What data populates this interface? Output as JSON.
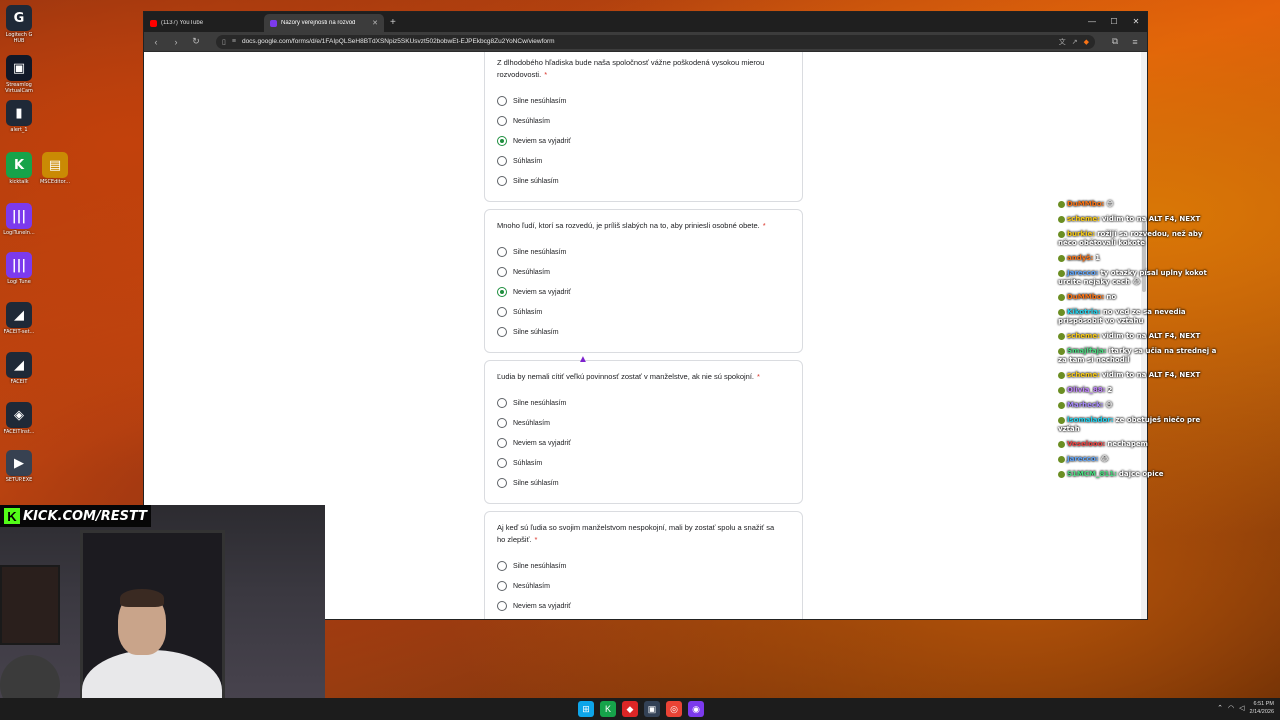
{
  "desktop": {
    "icons": [
      {
        "name": "logitech-ghub-icon",
        "label": "Logitech G HUB",
        "glyph": "G",
        "color": "#1f2937"
      },
      {
        "name": "streamlabs-icon",
        "label": "Streamlog VirtualCam",
        "glyph": "▣",
        "color": "#111827"
      },
      {
        "name": "alert-icon",
        "label": "alert_1",
        "glyph": "▮",
        "color": "#1f2937"
      },
      {
        "name": "kicktalk-icon",
        "label": "kicktalk",
        "glyph": "K",
        "color": "#16a34a"
      },
      {
        "name": "msceditor-icon",
        "label": "MSCEditor...",
        "glyph": "▤",
        "color": "#ca8a04"
      },
      {
        "name": "logi-tune-icon-1",
        "label": "LogiTuneIn...",
        "glyph": "|||",
        "color": "#7c3aed"
      },
      {
        "name": "logi-tune-icon-2",
        "label": "Logi Tune",
        "glyph": "|||",
        "color": "#7c3aed"
      },
      {
        "name": "faceit-setup-icon",
        "label": "FACEIT-set...",
        "glyph": "◢",
        "color": "#1f2937"
      },
      {
        "name": "faceit-icon",
        "label": "FACEIT",
        "glyph": "◢",
        "color": "#1f2937"
      },
      {
        "name": "faceit-inst-icon",
        "label": "FACEITInst...",
        "glyph": "◈",
        "color": "#1f2937"
      },
      {
        "name": "setup-icon",
        "label": "SETUP.EXE",
        "glyph": "▶",
        "color": "#374151"
      }
    ]
  },
  "browser": {
    "tabs": [
      {
        "title": "(1137) YouTube",
        "fav": "#ff0000"
      },
      {
        "title": "Názory verejnosti na rozvod",
        "fav": "#7c3aed"
      }
    ],
    "new_tab": "+",
    "url": "docs.google.com/forms/d/e/1FAIpQLSeH8BTdXSNpiz5SKUsvzt502bobwEt-EJPEkbcg8Zu2YoNCw/viewform"
  },
  "form": {
    "cards": [
      {
        "question": "Z dlhodobého hľadiska bude naša spoločnosť vážne poškodená vysokou mierou rozvodovosti.",
        "required": "*",
        "selected": 2,
        "options": [
          "Silne nesúhlasím",
          "Nesúhlasím",
          "Neviem sa vyjadriť",
          "Súhlasím",
          "Silne súhlasím"
        ]
      },
      {
        "question": "Mnoho ľudí, ktorí sa rozvedú, je príliš slabých na to, aby priniesli osobné obete.",
        "required": "*",
        "selected": 2,
        "options": [
          "Silne nesúhlasím",
          "Nesúhlasím",
          "Neviem sa vyjadriť",
          "Súhlasím",
          "Silne súhlasím"
        ]
      },
      {
        "question": "Ľudia by nemali cítiť veľkú povinnosť zostať v manželstve, ak nie sú spokojní.",
        "required": "*",
        "selected": -1,
        "options": [
          "Silne nesúhlasím",
          "Nesúhlasím",
          "Neviem sa vyjadriť",
          "Súhlasím",
          "Silne súhlasím"
        ]
      },
      {
        "question": "Aj keď sú ľudia so svojim manželstvom nespokojní, mali by zostať spolu a snažiť sa ho zlepšiť.",
        "required": "*",
        "selected": -1,
        "options": [
          "Silne nesúhlasím",
          "Nesúhlasím",
          "Neviem sa vyjadriť"
        ]
      }
    ]
  },
  "chat": [
    {
      "user": "DuMMbo:",
      "msg": "😊",
      "color": "#f97316"
    },
    {
      "user": "scheme:",
      "msg": "vidim to na ALT F4, NEXT",
      "color": "#facc15"
    },
    {
      "user": "burkie:",
      "msg": "rožijí sa rozvedou, než aby něco obětovali kokote",
      "color": "#facc15"
    },
    {
      "user": "andyš:",
      "msg": "1",
      "color": "#f97316"
    },
    {
      "user": "Jarecco:",
      "msg": "ty otazky písal uplny kokot urcite nejaky cech 😂",
      "color": "#60a5fa"
    },
    {
      "user": "DuMMbo:",
      "msg": "no",
      "color": "#f97316"
    },
    {
      "user": "Kikotria:",
      "msg": "no ved ze sa nevedia prispôsobiť vo vzťahu",
      "color": "#22d3ee"
    },
    {
      "user": "scheme:",
      "msg": "vidim to na ALT F4, NEXT",
      "color": "#facc15"
    },
    {
      "user": "Smajlfaja:",
      "msg": "itarky sa učia na strednej a za tam si nechodil",
      "color": "#4ade80"
    },
    {
      "user": "scheme:",
      "msg": "vidim to na ALT F4, NEXT",
      "color": "#facc15"
    },
    {
      "user": "Olivia_88:",
      "msg": "2",
      "color": "#c084fc"
    },
    {
      "user": "Marheck:",
      "msg": "😅",
      "color": "#a78bfa"
    },
    {
      "user": "lsomalador:",
      "msg": "ze obetuješ niečo pre vzťah",
      "color": "#22d3ee"
    },
    {
      "user": "Veselooo:",
      "msg": "nechapem",
      "color": "#ef4444"
    },
    {
      "user": "Jarecco:",
      "msg": "😂",
      "color": "#60a5fa"
    },
    {
      "user": "S1MCM_811:",
      "msg": "dajce opice",
      "color": "#4ade80"
    }
  ],
  "stream": {
    "banner": "KICK.COM/RESTT"
  },
  "taskbar": {
    "apps": [
      {
        "name": "start-icon",
        "glyph": "⊞",
        "color": "#0ea5e9"
      },
      {
        "name": "kick-app-icon",
        "glyph": "K",
        "color": "#16a34a"
      },
      {
        "name": "brave-icon",
        "glyph": "◆",
        "color": "#dc2626"
      },
      {
        "name": "terminal-icon",
        "glyph": "▣",
        "color": "#334155"
      },
      {
        "name": "chrome-icon",
        "glyph": "◎",
        "color": "#ea4335"
      },
      {
        "name": "twitch-app-icon",
        "glyph": "◉",
        "color": "#7c3aed"
      }
    ],
    "time": "6:51 PM",
    "date": "2/14/2026"
  }
}
